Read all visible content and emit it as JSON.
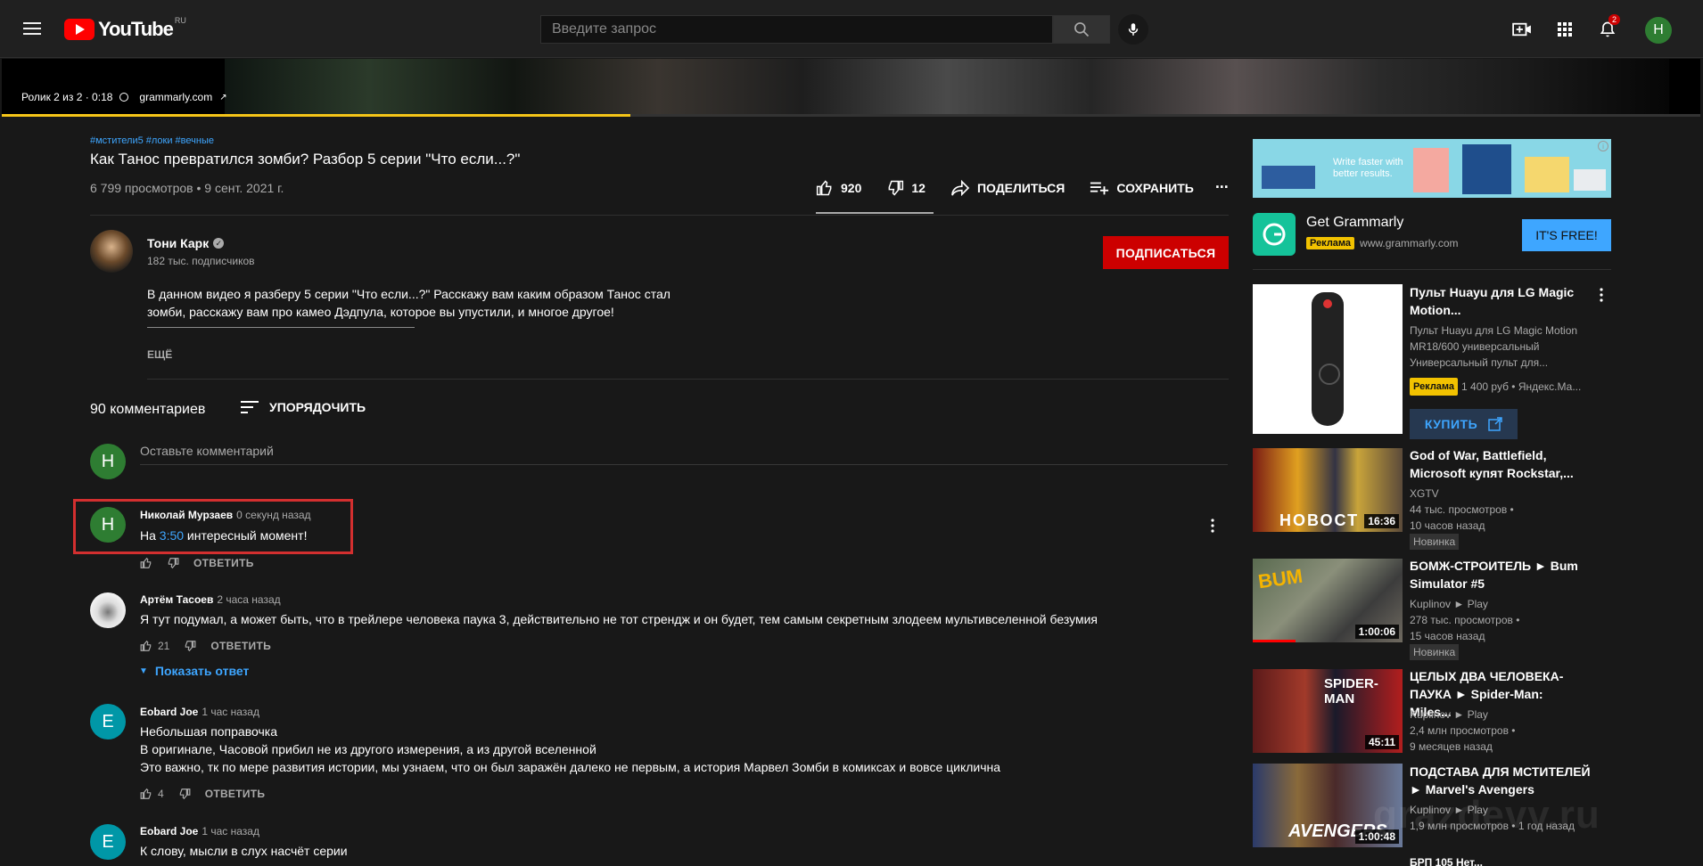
{
  "header": {
    "logo_text": "YouTube",
    "country_code": "RU",
    "search_placeholder": "Введите запрос",
    "notif_count": "2",
    "avatar_letter": "Н"
  },
  "player": {
    "overlay_label": "Ролик 2 из 2 · 0:18",
    "overlay_link": "grammarly.com",
    "progress": 0.37
  },
  "video": {
    "hashtags": "#мстители5 #локи #вечные",
    "title": "Как Танос превратился зомби? Разбор 5 серии \"Что если...?\"",
    "views": "6 799 просмотров • 9 сент. 2021 г.",
    "likes": "920",
    "dislikes": "12",
    "share": "ПОДЕЛИТЬСЯ",
    "save": "СОХРАНИТЬ"
  },
  "channel": {
    "name": "Тони Карк",
    "subs": "182 тыс. подписчиков",
    "subscribe": "ПОДПИСАТЬСЯ",
    "desc_line1": "В данном видео я разберу 5 серии \"Что если...?\" Расскажу вам каким образом Танос стал",
    "desc_line2": "зомби, расскажу вам про камео Дэдпула, которое вы упустили, и многое другое!",
    "more": "ЕЩЁ"
  },
  "comments_header": {
    "count": "90 комментариев",
    "sort": "УПОРЯДОЧИТЬ",
    "add_placeholder": "Оставьте комментарий",
    "avatar_letter": "Н"
  },
  "comments": [
    {
      "author": "Николай Мурзаев",
      "time": "0 секунд назад",
      "text_prefix": "На ",
      "timestamp": "3:50",
      "text_suffix": " интересный момент!",
      "avatar": "Н",
      "likes": "",
      "reply": "ОТВЕТИТЬ"
    },
    {
      "author": "Артём Тасоев",
      "time": "2 часа назад",
      "text": "Я тут подумал, а может быть, что в трейлере человека паука 3, действительно не тот стрендж и он будет, тем самым  секретным злодеем мультивселенной безумия",
      "likes": "21",
      "reply": "ОТВЕТИТЬ",
      "show_reply": "Показать ответ"
    },
    {
      "author": "Eobard Joe",
      "time": "1 час назад",
      "avatar": "E",
      "line1": "Небольшая поправочка",
      "line2": "В оригинале, Часовой прибил не из другого измерения, а из другой вселенной",
      "line3": "Это важно, тк по мере развития истории, мы узнаем, что он был заражён далеко не первым, а история Марвел Зомби в комиксах и вовсе циклична",
      "likes": "4",
      "reply": "ОТВЕТИТЬ"
    },
    {
      "author": "Eobard Joe",
      "time": "1 час назад",
      "avatar": "E",
      "text": "К слову, мысли в слух насчёт серии"
    }
  ],
  "sidebar": {
    "banner_text": "Write faster with better results.",
    "ad_title": "Get Grammarly",
    "ad_badge": "Реклама",
    "ad_domain": "www.grammarly.com",
    "ad_cta": "IT'S FREE!",
    "shop": {
      "title": "Пульт Huayu для LG Magic Motion...",
      "desc": "Пульт Huayu для LG Magic Motion MR18/600 универсальный Универсальный пульт для...",
      "badge": "Реклама",
      "price": "1 400 руб • Яндекс.Ма...",
      "buy": "КУПИТЬ"
    },
    "videos": [
      {
        "title": "God of War, Battlefield, Microsoft купят Rockstar,...",
        "channel": "XGTV",
        "views": "44 тыс. просмотров •",
        "age": "10 часов назад",
        "badge": "Новинка",
        "duration": "16:36",
        "thumb_text": "НОВОСТ"
      },
      {
        "title": "БОМЖ-СТРОИТЕЛЬ ► Bum Simulator #5",
        "channel": "Kuplinov ► Play",
        "views": "278 тыс. просмотров •",
        "age": "15 часов назад",
        "badge": "Новинка",
        "duration": "1:00:06",
        "thumb_text": "BUM"
      },
      {
        "title": "ЦЕЛЫХ ДВА ЧЕЛОВЕКА-ПАУКА ► Spider-Man: Miles...",
        "channel": "Kuplinov ► Play",
        "views": "2,4 млн просмотров •",
        "age": "9 месяцев назад",
        "duration": "45:11",
        "thumb_text": "SPIDER-MAN"
      },
      {
        "title": "ПОДСТАВА ДЛЯ МСТИТЕЛЕЙ ► Marvel's Avengers",
        "channel": "Kuplinov ► Play",
        "views": "1,9 млн просмотров • 1 год назад",
        "duration": "1:00:48",
        "thumb_text": "AVENGERS"
      }
    ],
    "partial_next": "БРП 105 Нет..."
  },
  "watermark": "grazdevv.ru",
  "colors": {
    "accent_blue": "#3ea6ff",
    "subscribe_red": "#cc0000",
    "ad_yellow": "#f2c200",
    "avatar_green": "#2e7d32"
  }
}
